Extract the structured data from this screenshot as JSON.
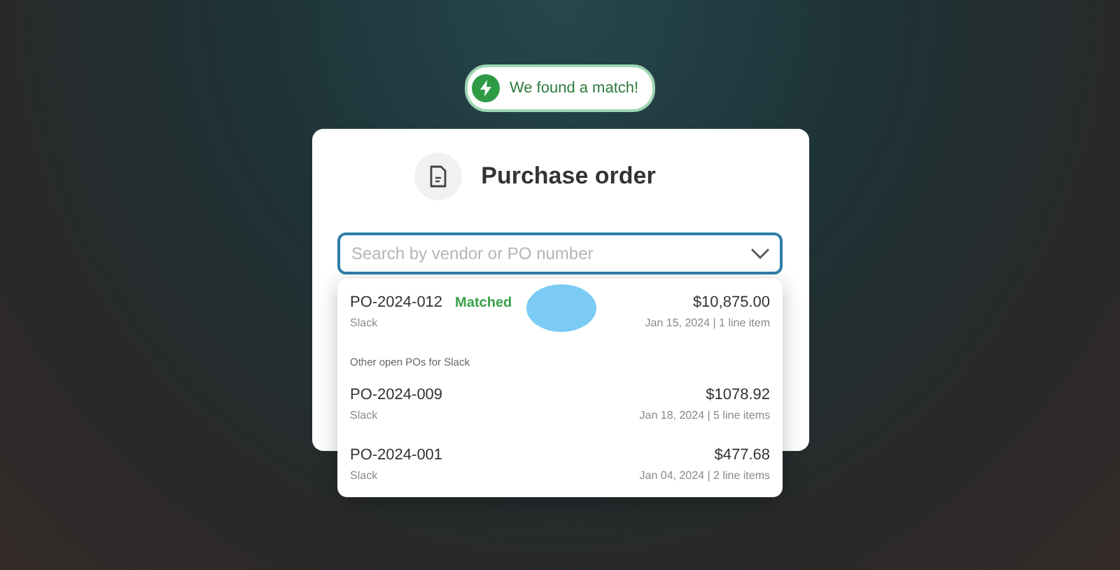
{
  "badge": {
    "text": "We found a match!"
  },
  "card": {
    "title": "Purchase order"
  },
  "search": {
    "placeholder": "Search by vendor or PO number"
  },
  "dropdown": {
    "matched": {
      "number": "PO-2024-012",
      "tag": "Matched",
      "vendor": "Slack",
      "amount": "$10,875.00",
      "details": "Jan 15, 2024 | 1 line item"
    },
    "section_label": "Other open POs for Slack",
    "others": [
      {
        "number": "PO-2024-009",
        "vendor": "Slack",
        "amount": "$1078.92",
        "details": "Jan 18, 2024 | 5 line items"
      },
      {
        "number": "PO-2024-001",
        "vendor": "Slack",
        "amount": "$477.68",
        "details": "Jan 04, 2024 | 2 line items"
      }
    ]
  }
}
